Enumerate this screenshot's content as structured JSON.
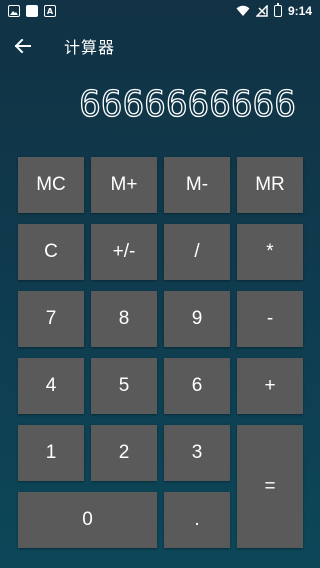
{
  "status_bar": {
    "time": "9:14",
    "left_icons": [
      "image-icon",
      "square-icon",
      "a-icon"
    ],
    "right_icons": [
      "wifi-icon",
      "signal-icon",
      "battery-icon"
    ]
  },
  "toolbar": {
    "back_icon": "arrow-left-icon",
    "title": "计算器"
  },
  "display": {
    "value": "6666666666"
  },
  "keys": {
    "mc": "MC",
    "m_plus": "M+",
    "m_minus": "M-",
    "mr": "MR",
    "clear": "C",
    "sign": "+/-",
    "divide": "/",
    "multiply": "*",
    "seven": "7",
    "eight": "8",
    "nine": "9",
    "minus": "-",
    "four": "4",
    "five": "5",
    "six": "6",
    "plus": "+",
    "one": "1",
    "two": "2",
    "three": "3",
    "equals": "=",
    "zero": "0",
    "dot": "."
  },
  "colors": {
    "background_top": "#103244",
    "background_bottom": "#0c4758",
    "key_background": "#5a5a5a",
    "key_text": "#ffffff"
  }
}
